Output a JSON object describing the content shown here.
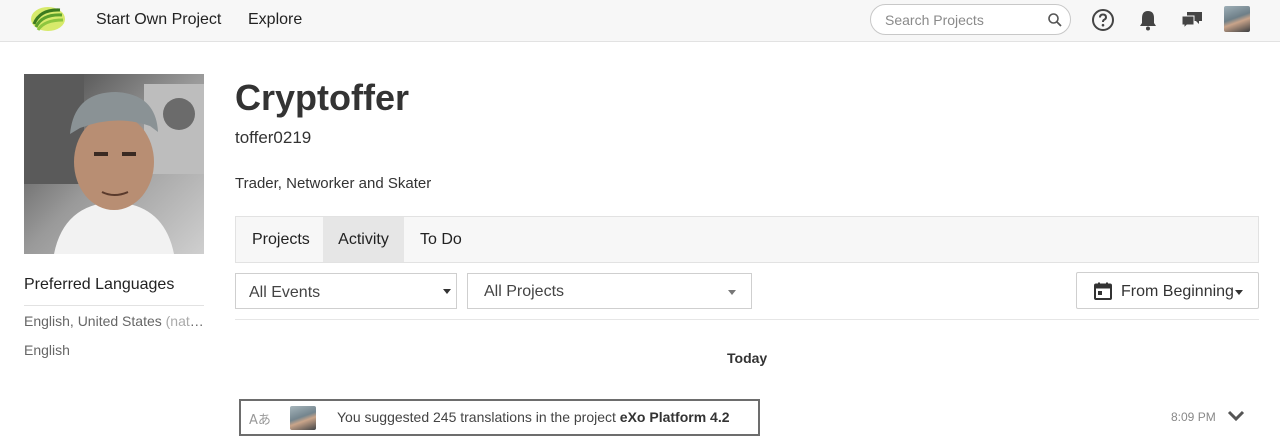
{
  "header": {
    "logo_icon": "zanata-logo-icon",
    "nav": {
      "start_own_project": "Start Own Project",
      "explore": "Explore"
    },
    "search": {
      "placeholder": "Search Projects",
      "icon": "search-icon"
    },
    "icons": [
      "help-icon",
      "bell-icon",
      "chat-icon"
    ],
    "user_avatar": "avatar"
  },
  "profile": {
    "name": "Cryptoffer",
    "username": "toffer0219",
    "bio": "Trader, Networker and Skater",
    "preferred_languages": {
      "title": "Preferred Languages",
      "items": [
        {
          "name": "English, United States",
          "note": "(native)"
        },
        {
          "name": "English",
          "note": ""
        }
      ]
    }
  },
  "tabs": [
    {
      "label": "Projects",
      "active": false
    },
    {
      "label": "Activity",
      "active": true
    },
    {
      "label": "To Do",
      "active": false
    }
  ],
  "filters": {
    "events": {
      "selected": "All Events"
    },
    "projects": {
      "selected": "All Projects"
    },
    "date_range": {
      "label": "From Beginning",
      "icon": "calendar-icon"
    }
  },
  "activity": {
    "groups": [
      {
        "heading": "Today",
        "events": [
          {
            "icon": "translation-icon",
            "text_prefix": "You suggested 245 translations in the project ",
            "project": "eXo Platform 4.2",
            "time": "8:09 PM"
          }
        ]
      }
    ]
  },
  "colors": {
    "accent_green": "#8dc63f",
    "active_tab": "#e6e6e6",
    "border": "#cfcfcf"
  }
}
